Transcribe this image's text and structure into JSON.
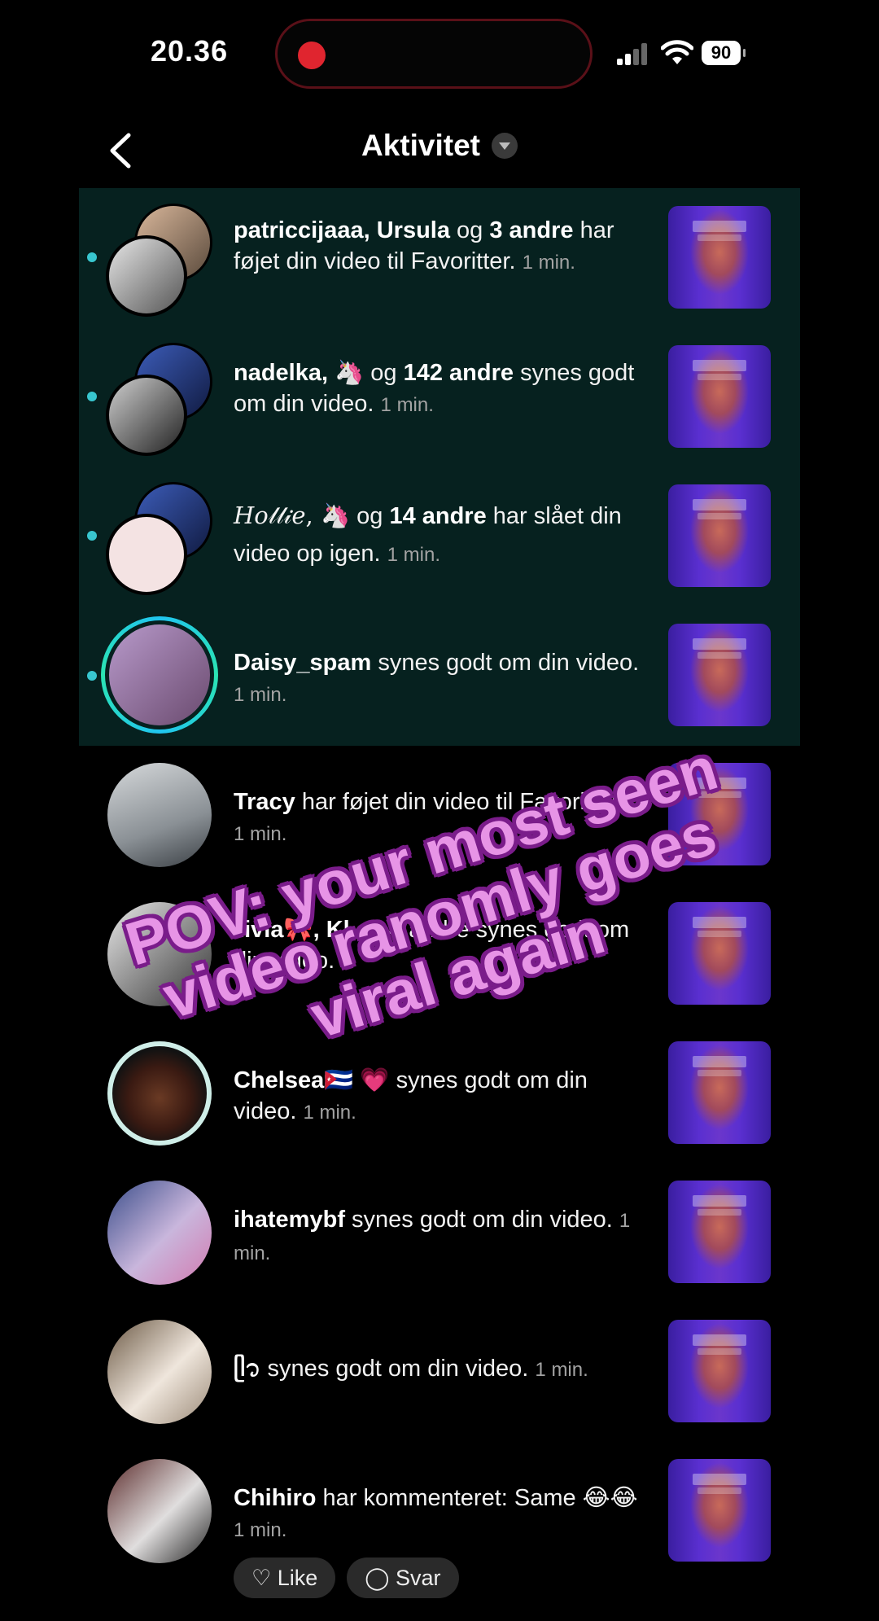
{
  "status_bar": {
    "time": "20.36",
    "battery": "90"
  },
  "header": {
    "title": "Aktivitet"
  },
  "colors": {
    "unread_bg": "#06211f",
    "unread_dot": "#38c6cf",
    "caption_fill": "#e794e6",
    "caption_outline": "#7a1c8a",
    "recording": "#e0252f"
  },
  "notifications": [
    {
      "actors": "patriccijaaa, Ursula",
      "mid": " og ",
      "count": "3 andre",
      "action": " har føjet din video til Favoritter. ",
      "time": "1 min.",
      "unread": true
    },
    {
      "actors": "nadelka, ",
      "emoji": "🦄",
      "mid": " og ",
      "count": "142 andre",
      "action": " synes godt om din video. ",
      "time": "1 min.",
      "unread": true
    },
    {
      "actors": "𝐻𝑜𝓁𝓁𝒾𝑒, ",
      "emoji": "🦄",
      "mid": " og ",
      "count": "14 andre",
      "action": " har slået din video op igen. ",
      "time": "1 min.",
      "unread": true
    },
    {
      "actors": "Daisy_spam",
      "action": " synes godt om din video. ",
      "time": "1 min.",
      "unread": true
    },
    {
      "actors": "Tracy",
      "action": " har føjet din video til Favoritter. ",
      "time": "1 min.",
      "unread": false
    },
    {
      "actors": "ʟivia🎀, Kl",
      "mid": " og ",
      "count": "4",
      "action": " andre synes godt om din video. ",
      "time": "1",
      "unread": false
    },
    {
      "actors": "Chelsea🇨🇺 💗",
      "action": " synes godt om din video. ",
      "time": "1 min.",
      "unread": false
    },
    {
      "actors": "ihatemybf",
      "action": " synes godt om din video. ",
      "time": "1 min.",
      "unread": false
    },
    {
      "actors": "ᥫ᭡",
      "action": " synes godt om din video. ",
      "time": "1 min.",
      "unread": false
    },
    {
      "actors": "Chihiro",
      "action": " har kommenteret: Same 😂😂 ",
      "time": "1 min.",
      "unread": false,
      "like_label": "Like",
      "reply_label": "Svar"
    }
  ],
  "overlay_caption": "POV: your most seen video ranomly goes viral again"
}
